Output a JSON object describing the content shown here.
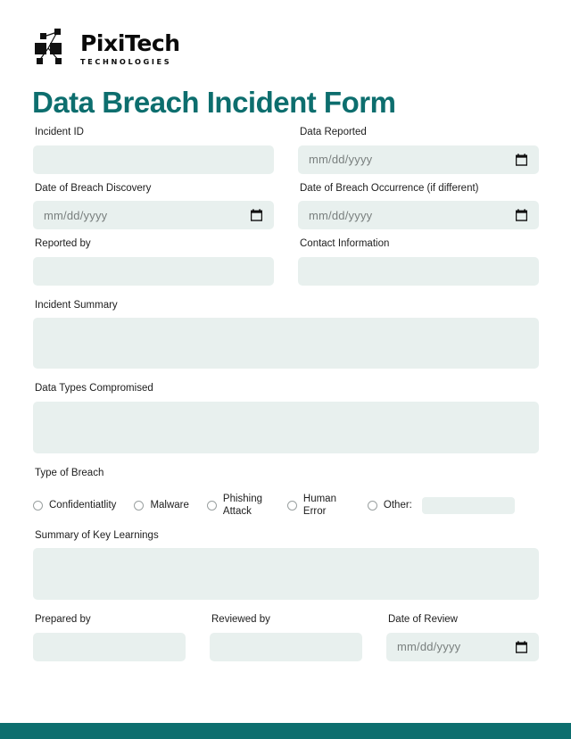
{
  "brand": {
    "name": "PixiTech",
    "tagline": "TECHNOLOGIES",
    "logo_icon": "circuit-nodes-icon"
  },
  "title": "Data Breach Incident Form",
  "colors": {
    "accent_teal": "#0d6e6e",
    "field_background": "#e8f0ee",
    "label_text": "#1d1d1d",
    "placeholder_text": "#797f7e",
    "page_background": "#ffffff"
  },
  "fields": {
    "incident_id": {
      "label": "Incident ID",
      "value": "",
      "placeholder": ""
    },
    "data_reported": {
      "label": "Data Reported",
      "value": "",
      "placeholder": "mm/dd/yyyy",
      "type": "date"
    },
    "breach_discovery": {
      "label": "Date of Breach Discovery",
      "value": "",
      "placeholder": "mm/dd/yyyy",
      "type": "date"
    },
    "breach_occurrence": {
      "label": "Date of Breach Occurrence (if different)",
      "value": "",
      "placeholder": "mm/dd/yyyy",
      "type": "date"
    },
    "reported_by": {
      "label": "Reported by",
      "value": "",
      "placeholder": ""
    },
    "contact_information": {
      "label": "Contact Information",
      "value": "",
      "placeholder": ""
    },
    "incident_summary": {
      "label": "Incident Summary",
      "value": "",
      "placeholder": ""
    },
    "data_types_compromised": {
      "label": "Data Types Compromised",
      "value": "",
      "placeholder": ""
    },
    "summary_key_learnings": {
      "label": "Summary of Key Learnings",
      "value": "",
      "placeholder": ""
    },
    "prepared_by": {
      "label": "Prepared by",
      "value": "",
      "placeholder": ""
    },
    "reviewed_by": {
      "label": "Reviewed by",
      "value": "",
      "placeholder": ""
    },
    "date_of_review": {
      "label": "Date of Review",
      "value": "",
      "placeholder": "mm/dd/yyyy",
      "type": "date"
    }
  },
  "type_of_breach": {
    "label": "Type of Breach",
    "selected": null,
    "options": [
      {
        "label": "Confidentiatlity",
        "checked": false
      },
      {
        "label": "Malware",
        "checked": false
      },
      {
        "label": "Phishing Attack",
        "checked": false
      },
      {
        "label": "Human Error",
        "checked": false
      },
      {
        "label": "Other:",
        "checked": false,
        "has_text_input": true,
        "text_value": ""
      }
    ]
  },
  "icons": {
    "calendar": "calendar-icon",
    "radio": "radio-button-icon"
  }
}
